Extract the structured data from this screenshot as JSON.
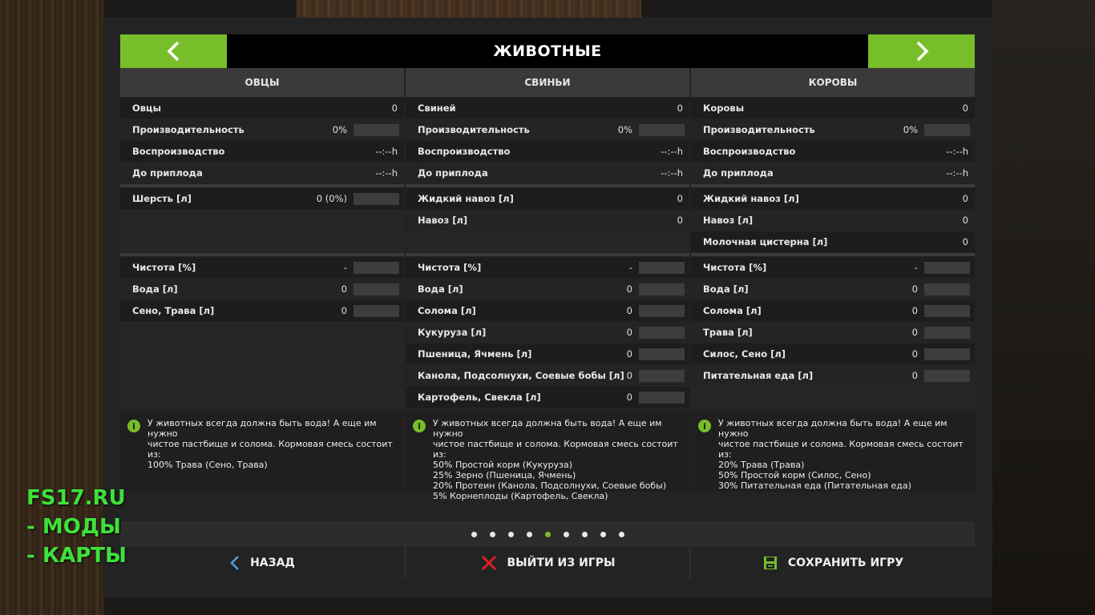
{
  "header": {
    "title": "ЖИВОТНЫЕ"
  },
  "columns": [
    {
      "name": "ОВЦЫ",
      "rows": [
        {
          "label": "Овцы",
          "value": "0"
        },
        {
          "label": "Производительность",
          "value": "0%"
        },
        {
          "label": "Воспроизводство",
          "value": "--:--h"
        },
        {
          "label": "До приплода",
          "value": "--:--h"
        },
        {
          "label": "Шерсть [л]",
          "value": "0 (0%)"
        },
        {
          "label": "Чистота [%]",
          "value": "-"
        },
        {
          "label": "Вода [л]",
          "value": "0"
        },
        {
          "label": "Сено, Трава [л]",
          "value": "0"
        }
      ],
      "info": "У животных всегда должна быть вода! А еще им нужно\nчистое пастбище и солома. Кормовая смесь состоит\nиз:\n100% Трава (Сено, Трава)"
    },
    {
      "name": "СВИНЬИ",
      "rows": [
        {
          "label": "Свиней",
          "value": "0"
        },
        {
          "label": "Производительность",
          "value": "0%"
        },
        {
          "label": "Воспроизводство",
          "value": "--:--h"
        },
        {
          "label": "До приплода",
          "value": "--:--h"
        },
        {
          "label": "Жидкий навоз [л]",
          "value": "0"
        },
        {
          "label": "Навоз [л]",
          "value": "0"
        },
        {
          "label": "Чистота [%]",
          "value": "-"
        },
        {
          "label": "Вода [л]",
          "value": "0"
        },
        {
          "label": "Солома [л]",
          "value": "0"
        },
        {
          "label": "Кукуруза [л]",
          "value": "0"
        },
        {
          "label": "Пшеница, Ячмень [л]",
          "value": "0"
        },
        {
          "label": "Канола, Подсолнухи, Соевые бобы [л]",
          "value": "0"
        },
        {
          "label": "Картофель, Свекла [л]",
          "value": "0"
        }
      ],
      "info": "У животных всегда должна быть вода! А еще им нужно\nчистое пастбище и солома. Кормовая смесь состоит\nиз:\n50% Простой корм (Кукуруза)\n25% Зерно (Пшеница, Ячмень)\n20% Протеин (Канола, Подсолнухи, Соевые бобы)\n5% Корнеплоды (Картофель, Свекла)"
    },
    {
      "name": "КОРОВЫ",
      "rows": [
        {
          "label": "Коровы",
          "value": "0"
        },
        {
          "label": "Производительность",
          "value": "0%"
        },
        {
          "label": "Воспроизводство",
          "value": "--:--h"
        },
        {
          "label": "До приплода",
          "value": "--:--h"
        },
        {
          "label": "Жидкий навоз [л]",
          "value": "0"
        },
        {
          "label": "Навоз [л]",
          "value": "0"
        },
        {
          "label": "Молочная цистерна [л]",
          "value": "0"
        },
        {
          "label": "Чистота [%]",
          "value": "-"
        },
        {
          "label": "Вода [л]",
          "value": "0"
        },
        {
          "label": "Солома [л]",
          "value": "0"
        },
        {
          "label": "Трава [л]",
          "value": "0"
        },
        {
          "label": "Силос, Сено [л]",
          "value": "0"
        },
        {
          "label": "Питательная еда [л]",
          "value": "0"
        }
      ],
      "info": "У животных всегда должна быть вода! А еще им нужно\nчистое пастбище и солома. Кормовая смесь состоит\nиз:\n20% Трава (Трава)\n50% Простой корм (Силос, Сено)\n30% Питательная еда (Питательная еда)"
    }
  ],
  "pagination": {
    "count": 9,
    "active_index": 4
  },
  "footer": {
    "back_label": "НАЗАД",
    "quit_label": "ВЫЙТИ ИЗ ИГРЫ",
    "save_label": "СОХРАНИТЬ ИГРУ"
  },
  "watermark": {
    "line1": "FS17.RU",
    "line2": "- МОДЫ",
    "line3": "- КАРТЫ"
  },
  "colors": {
    "accent": "#78be2a",
    "panel": "#232323",
    "header": "#000000",
    "quit_icon": "#e02020",
    "back_icon": "#4aa3df"
  },
  "icons": {
    "prev": "chevron-left-icon",
    "next": "chevron-right-icon",
    "info": "info-icon",
    "back": "back-arrow-icon",
    "quit": "close-icon",
    "save": "save-disk-icon"
  }
}
